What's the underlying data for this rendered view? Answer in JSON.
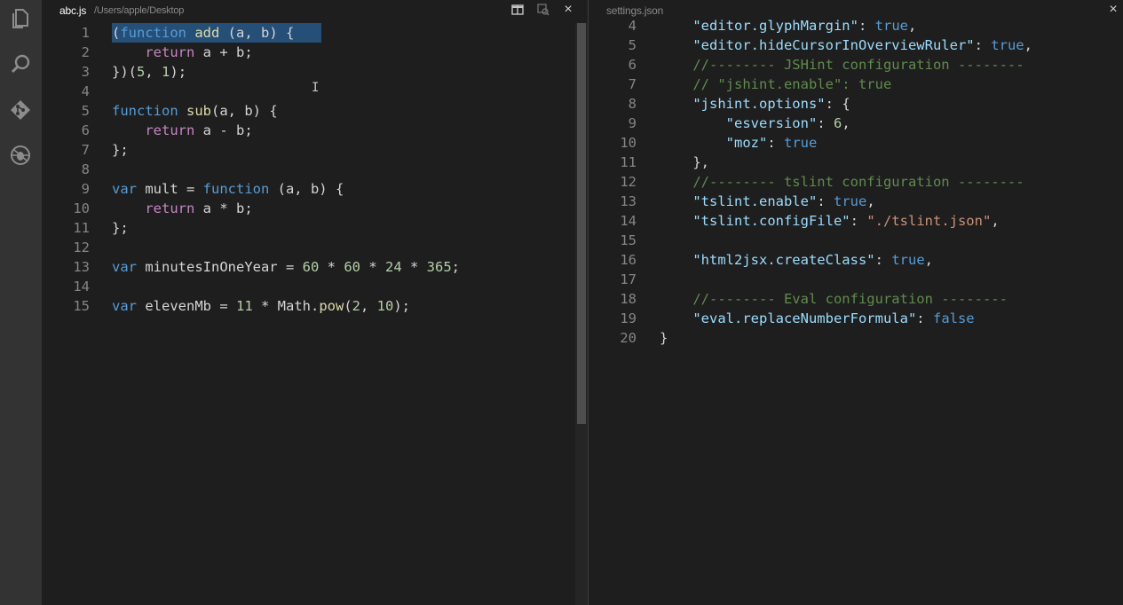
{
  "activity_bar": {
    "icons": [
      "explorer-icon",
      "search-icon",
      "git-icon",
      "debug-icon"
    ]
  },
  "left_editor": {
    "tab": {
      "file": "abc.js",
      "path": "/Users/apple/Desktop"
    },
    "actions": {
      "split_icon": "split-editor-icon",
      "preview_icon": "open-changes-icon",
      "close_label": "×"
    },
    "lines": [
      {
        "n": "1",
        "code": "(function add (a, b) {"
      },
      {
        "n": "2",
        "code": "    return a + b;"
      },
      {
        "n": "3",
        "code": "})(5, 1);"
      },
      {
        "n": "4",
        "code": ""
      },
      {
        "n": "5",
        "code": "function sub(a, b) {"
      },
      {
        "n": "6",
        "code": "    return a - b;"
      },
      {
        "n": "7",
        "code": "};"
      },
      {
        "n": "8",
        "code": ""
      },
      {
        "n": "9",
        "code": "var mult = function (a, b) {"
      },
      {
        "n": "10",
        "code": "    return a * b;"
      },
      {
        "n": "11",
        "code": "};"
      },
      {
        "n": "12",
        "code": ""
      },
      {
        "n": "13",
        "code": "var minutesInOneYear = 60 * 60 * 24 * 365;"
      },
      {
        "n": "14",
        "code": ""
      },
      {
        "n": "15",
        "code": "var elevenMb = 11 * Math.pow(2, 10);"
      }
    ]
  },
  "right_editor": {
    "tab": {
      "file": "settings.json"
    },
    "actions": {
      "close_label": "×"
    },
    "lines": [
      {
        "n": "4",
        "code": "    \"editor.glyphMargin\": true,"
      },
      {
        "n": "5",
        "code": "    \"editor.hideCursorInOverviewRuler\": true,"
      },
      {
        "n": "6",
        "code": "    //-------- JSHint configuration --------"
      },
      {
        "n": "7",
        "code": "    // \"jshint.enable\": true"
      },
      {
        "n": "8",
        "code": "    \"jshint.options\": {"
      },
      {
        "n": "9",
        "code": "        \"esversion\": 6,"
      },
      {
        "n": "10",
        "code": "        \"moz\": true"
      },
      {
        "n": "11",
        "code": "    },"
      },
      {
        "n": "12",
        "code": "    //-------- tslint configuration --------"
      },
      {
        "n": "13",
        "code": "    \"tslint.enable\": true,"
      },
      {
        "n": "14",
        "code": "    \"tslint.configFile\": \"./tslint.json\","
      },
      {
        "n": "15",
        "code": ""
      },
      {
        "n": "16",
        "code": "    \"html2jsx.createClass\": true,"
      },
      {
        "n": "17",
        "code": ""
      },
      {
        "n": "18",
        "code": "    //-------- Eval configuration --------"
      },
      {
        "n": "19",
        "code": "    \"eval.replaceNumberFormula\": false"
      },
      {
        "n": "20",
        "code": "}"
      }
    ]
  },
  "colors": {
    "background": "#1e1e1e",
    "activity_bar": "#333333",
    "selection": "#264f78",
    "keyword": "#569cd6",
    "function": "#dcdcaa",
    "number": "#b5cea8",
    "string": "#ce9178",
    "property": "#9cdcfe",
    "comment": "#608b4e"
  }
}
